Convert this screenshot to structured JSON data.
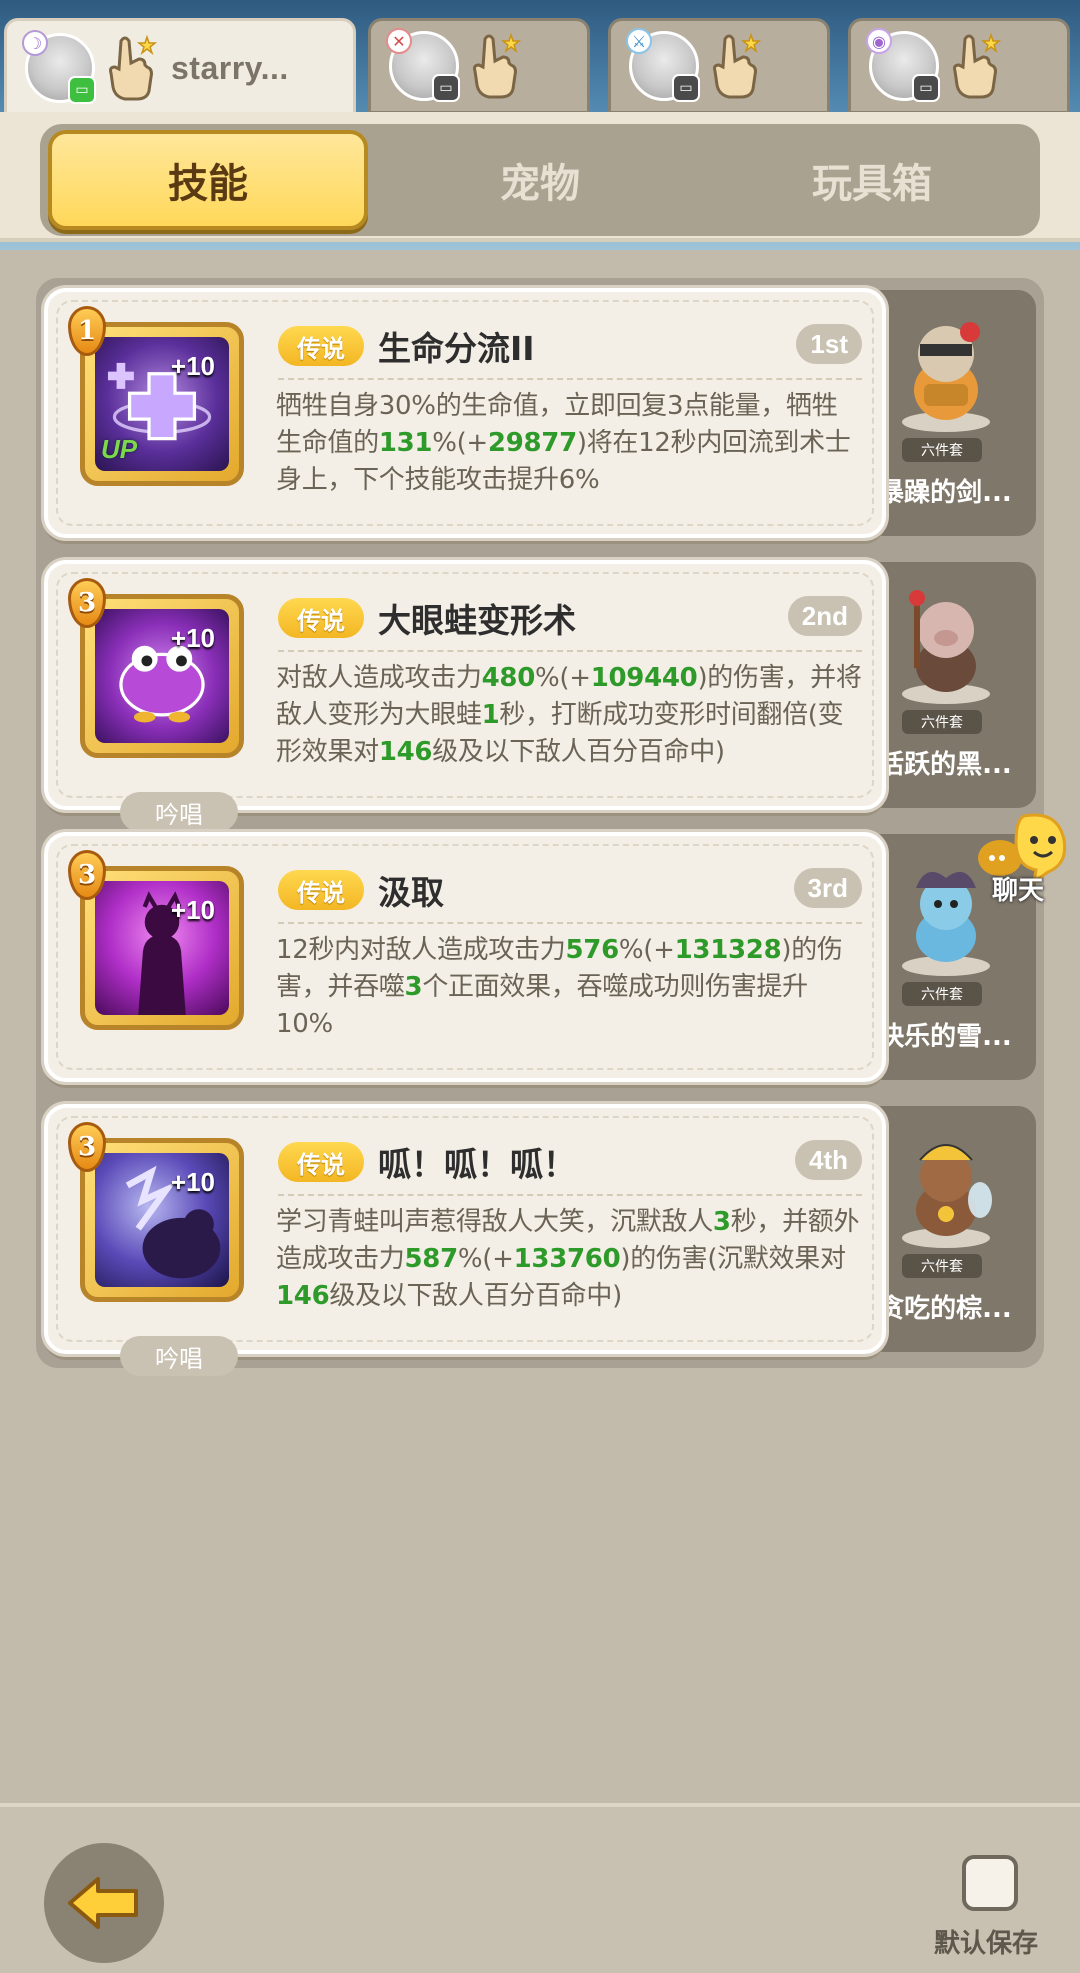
{
  "header": {
    "tabs": [
      {
        "name": "starry...",
        "element": "☽",
        "status": "online"
      },
      {
        "name": "",
        "element": "✕",
        "status": "offline"
      },
      {
        "name": "",
        "element": "⚔",
        "status": "offline"
      },
      {
        "name": "",
        "element": "◉",
        "status": "offline"
      }
    ]
  },
  "main_tabs": [
    "技能",
    "宠物",
    "玩具箱"
  ],
  "skills": [
    {
      "level": "1",
      "plus": "+10",
      "up": "UP",
      "chant": "",
      "rarity": "传说",
      "name": "生命分流II",
      "order": "1st",
      "desc_parts": [
        {
          "t": "牺牲自身30%的生命值，立即回复3点能量，牺牲生命值的"
        },
        {
          "t": "131",
          "g": true
        },
        {
          "t": "%(+"
        },
        {
          "t": "29877",
          "g": true
        },
        {
          "t": ")将在12秒内回流到术士身上，下个技能攻击提升6%"
        }
      ],
      "pet": {
        "set": "六件套",
        "name": "暴躁的剑..."
      }
    },
    {
      "level": "3",
      "plus": "+10",
      "up": "",
      "chant": "吟唱",
      "rarity": "传说",
      "name": "大眼蛙变形术",
      "order": "2nd",
      "desc_parts": [
        {
          "t": "对敌人造成攻击力"
        },
        {
          "t": "480",
          "g": true
        },
        {
          "t": "%(+"
        },
        {
          "t": "109440",
          "g": true
        },
        {
          "t": ")的伤害，并将敌人变形为大眼蛙"
        },
        {
          "t": "1",
          "g": true
        },
        {
          "t": "秒，打断成功变形时间翻倍(变形效果对"
        },
        {
          "t": "146",
          "g": true
        },
        {
          "t": "级及以下敌人百分百命中)"
        }
      ],
      "pet": {
        "set": "六件套",
        "name": "活跃的黑..."
      }
    },
    {
      "level": "3",
      "plus": "+10",
      "up": "",
      "chant": "",
      "rarity": "传说",
      "name": "汲取",
      "order": "3rd",
      "desc_parts": [
        {
          "t": "12秒内对敌人造成攻击力"
        },
        {
          "t": "576",
          "g": true
        },
        {
          "t": "%(+"
        },
        {
          "t": "131328",
          "g": true
        },
        {
          "t": ")的伤害，并吞噬"
        },
        {
          "t": "3",
          "g": true
        },
        {
          "t": "个正面效果，吞噬成功则伤害提升10%"
        }
      ],
      "pet": {
        "set": "六件套",
        "name": "快乐的雪..."
      }
    },
    {
      "level": "3",
      "plus": "+10",
      "up": "",
      "chant": "吟唱",
      "rarity": "传说",
      "name": "呱！呱！呱！",
      "order": "4th",
      "desc_parts": [
        {
          "t": "学习青蛙叫声惹得敌人大笑，沉默敌人"
        },
        {
          "t": "3",
          "g": true
        },
        {
          "t": "秒，并额外造成攻击力"
        },
        {
          "t": "587",
          "g": true
        },
        {
          "t": "%(+"
        },
        {
          "t": "133760",
          "g": true
        },
        {
          "t": ")的伤害(沉默效果对"
        },
        {
          "t": "146",
          "g": true
        },
        {
          "t": "级及以下敌人百分百命中)"
        }
      ],
      "pet": {
        "set": "六件套",
        "name": "贪吃的棕..."
      }
    }
  ],
  "chat": {
    "label": "聊天"
  },
  "bottom": {
    "save_label": "默认保存"
  }
}
